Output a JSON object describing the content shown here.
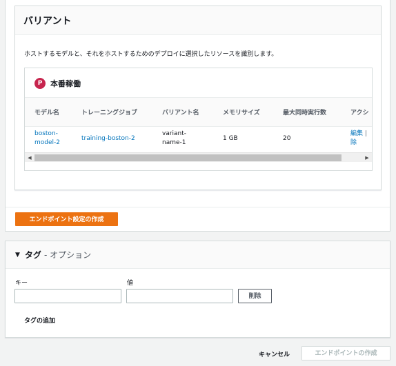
{
  "variants": {
    "title": "バリアント",
    "description": "ホストするモデルと、それをホストするためのデプロイに選択したリソースを識別します。",
    "production": {
      "badge": "P",
      "title": "本番稼働"
    },
    "table": {
      "headers": [
        "モデル名",
        "トレーニングジョブ",
        "バリアント名",
        "メモリサイズ",
        "最大同時実行数",
        "アクシ"
      ],
      "rows": [
        {
          "model_name_line1": "boston-",
          "model_name_line2": "model-2",
          "training_job": "training-boston-2",
          "variant_name_line1": "variant-",
          "variant_name_line2": "name-1",
          "memory_size": "1 GB",
          "max_concurrency": "20",
          "action_edit": "編集",
          "action_separator": "|",
          "action_delete_fragment": "除"
        }
      ]
    },
    "scroll_left_arrow": "◀",
    "scroll_right_arrow": "▶"
  },
  "create_config_button": "エンドポイント設定の作成",
  "tags": {
    "caret": "▼",
    "title": "タグ",
    "subtitle": "- オプション",
    "key_label": "キー",
    "value_label": "値",
    "key_value": "",
    "value_value": "",
    "delete_button": "削除",
    "add_tag": "タグの追加"
  },
  "footer": {
    "cancel": "キャンセル",
    "create_endpoint": "エンドポイントの作成"
  }
}
